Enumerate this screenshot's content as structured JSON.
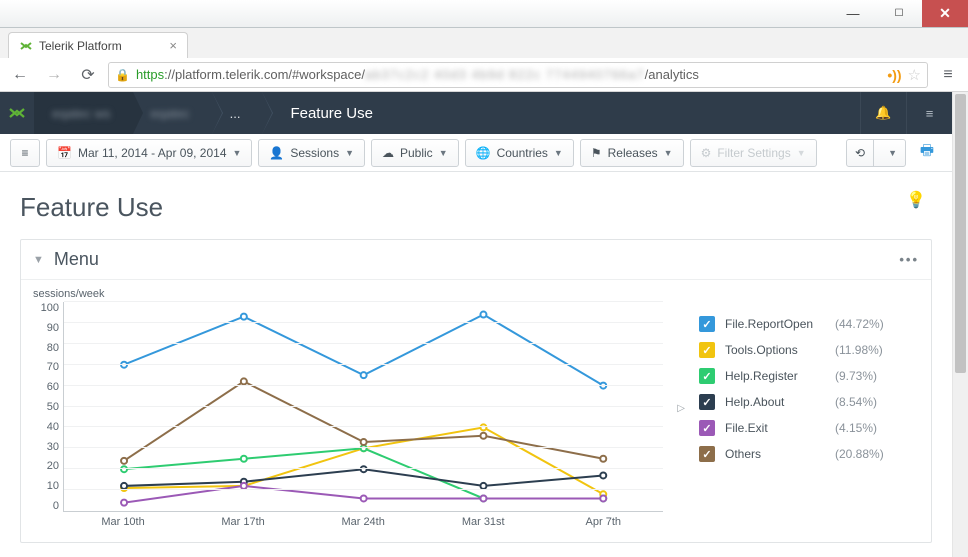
{
  "browser": {
    "tab_title": "Telerik Platform",
    "url_https": "https",
    "url_host": "://platform.telerik.com",
    "url_path": "/#workspace/",
    "url_masked": "ab37c2c2 40d3 4b9d 822c 7744940766a7",
    "url_tail": "/analytics"
  },
  "header": {
    "crumb1": "eqatec ws",
    "crumb2": "eqatec",
    "crumb3": "...",
    "page_title": "Feature Use"
  },
  "toolbar": {
    "date_range": "Mar 11, 2014 - Apr 09, 2014",
    "sessions": "Sessions",
    "public": "Public",
    "countries": "Countries",
    "releases": "Releases",
    "filter": "Filter Settings"
  },
  "content": {
    "h1": "Feature Use",
    "panel_title": "Menu",
    "ylabel": "sessions/week"
  },
  "chart_data": {
    "type": "line",
    "title": "Menu",
    "ylabel": "sessions/week",
    "xlabel": "",
    "ylim": [
      0,
      100
    ],
    "yticks": [
      0,
      10,
      20,
      30,
      40,
      50,
      60,
      70,
      80,
      90,
      100
    ],
    "categories": [
      "Mar 10th",
      "Mar 17th",
      "Mar 24th",
      "Mar 31st",
      "Apr 7th"
    ],
    "series": [
      {
        "name": "File.ReportOpen",
        "pct": "(44.72%)",
        "color": "#3498db",
        "values": [
          70,
          93,
          65,
          94,
          60
        ]
      },
      {
        "name": "Tools.Options",
        "pct": "(11.98%)",
        "color": "#f1c40f",
        "values": [
          11,
          12,
          30,
          40,
          8
        ]
      },
      {
        "name": "Help.Register",
        "pct": "(9.73%)",
        "color": "#2ecc71",
        "values": [
          20,
          25,
          30,
          6,
          6
        ]
      },
      {
        "name": "Help.About",
        "pct": "(8.54%)",
        "color": "#2c3e50",
        "values": [
          12,
          14,
          20,
          12,
          17
        ]
      },
      {
        "name": "File.Exit",
        "pct": "(4.15%)",
        "color": "#9b59b6",
        "values": [
          4,
          12,
          6,
          6,
          6
        ]
      },
      {
        "name": "Others",
        "pct": "(20.88%)",
        "color": "#8d6e4a",
        "values": [
          24,
          62,
          33,
          36,
          25
        ]
      }
    ]
  }
}
